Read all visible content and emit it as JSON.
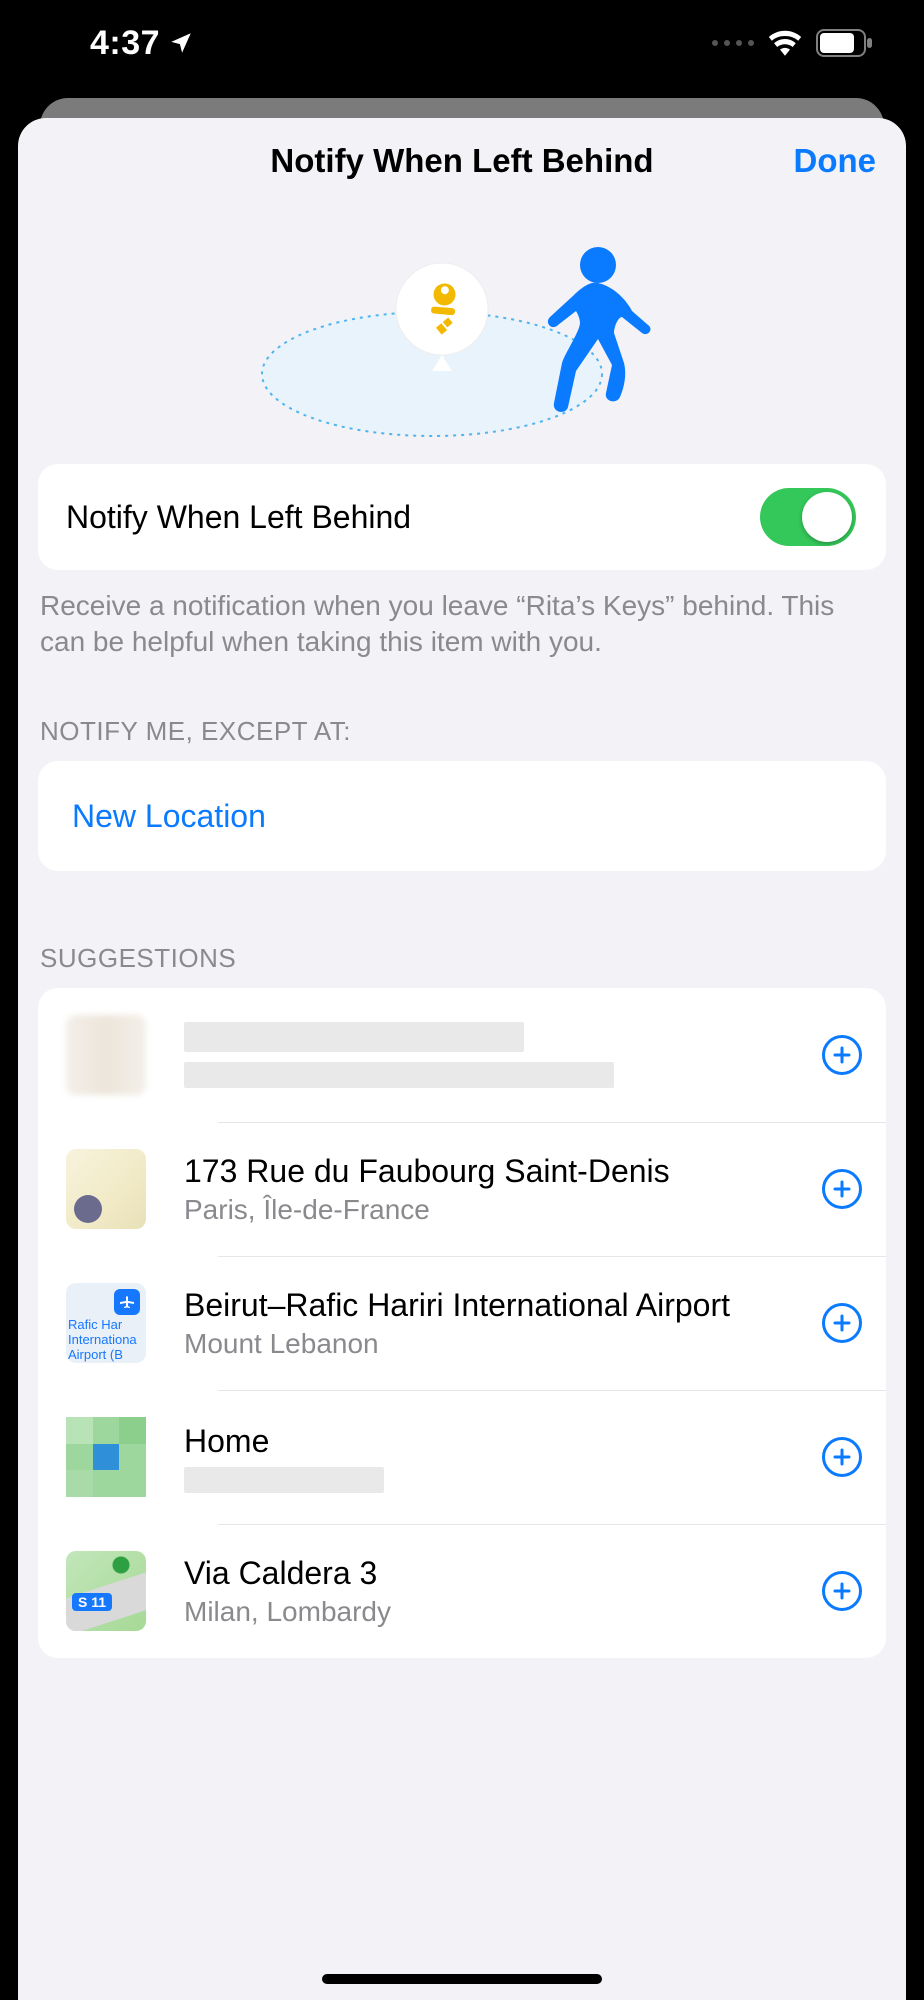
{
  "status": {
    "time": "4:37"
  },
  "header": {
    "title": "Notify When Left Behind",
    "done": "Done"
  },
  "toggle": {
    "label": "Notify When Left Behind",
    "on": true
  },
  "helpText": "Receive a notification when you leave “Rita’s Keys” behind. This can be helpful when taking this item with you.",
  "exceptSection": {
    "header": "NOTIFY ME, EXCEPT AT:",
    "newLocation": "New Location"
  },
  "suggestionsHeader": "SUGGESTIONS",
  "suggestions": [
    {
      "title": "",
      "subtitle": "",
      "redacted": true
    },
    {
      "title": "173 Rue du Faubourg Saint-Denis",
      "subtitle": "Paris, Île-de-France"
    },
    {
      "title": "Beirut–Rafic Hariri International Airport",
      "subtitle": "Mount Lebanon"
    },
    {
      "title": "Home",
      "subtitle": "",
      "subtitleRedacted": true
    },
    {
      "title": "Via Caldera 3",
      "subtitle": "Milan, Lombardy"
    }
  ],
  "airportThumbText": "Rafic Har\nInternationa\nAirport (B",
  "shieldText": "S 11"
}
